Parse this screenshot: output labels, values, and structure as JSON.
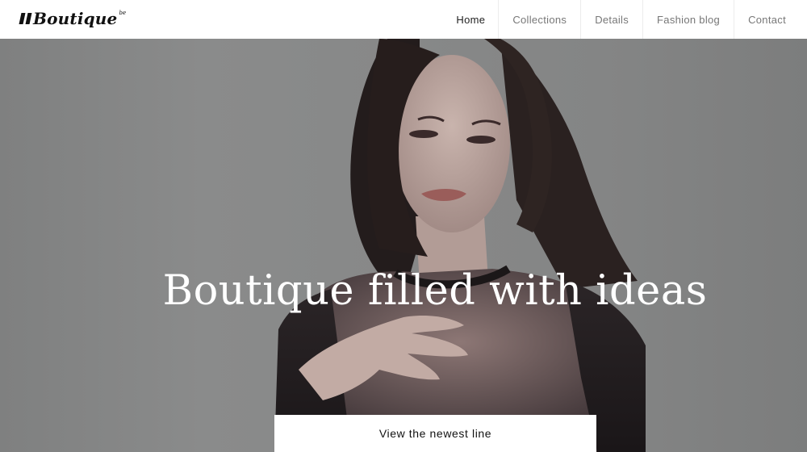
{
  "brand": {
    "name": "Boutique",
    "sup": "be"
  },
  "nav": {
    "items": [
      {
        "label": "Home"
      },
      {
        "label": "Collections"
      },
      {
        "label": "Details"
      },
      {
        "label": "Fashion blog"
      },
      {
        "label": "Contact"
      }
    ],
    "active": "Home"
  },
  "hero": {
    "title": "Boutique filled with ideas",
    "cta_label": "View the newest line"
  },
  "colors": {
    "background": "#ffffff",
    "hero_backdrop": "#858686",
    "text_dark": "#222222",
    "nav_text": "#777777"
  }
}
